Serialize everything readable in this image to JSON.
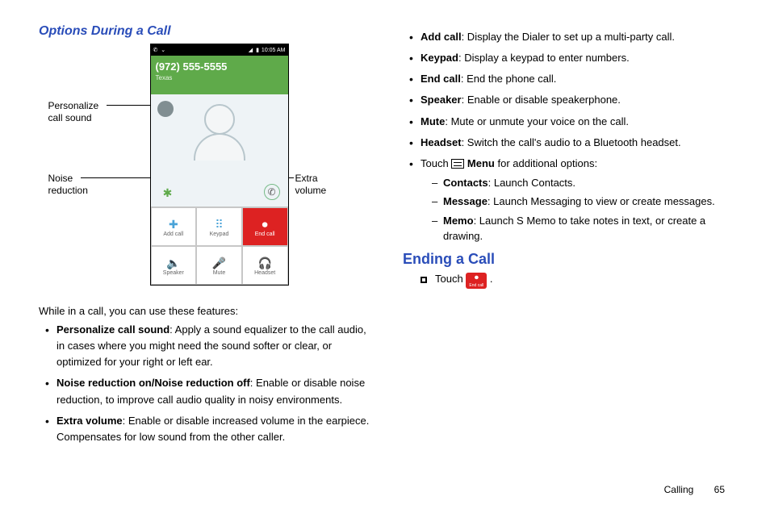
{
  "sections": {
    "options_title": "Options During a Call",
    "ending_title": "Ending a Call"
  },
  "phone": {
    "time": "10:05 AM",
    "signal_glyphs": "◢ ▮",
    "number": "(972) 555-5555",
    "location": "Texas",
    "noise_glyph": "✱",
    "extra_glyph": "✆",
    "buttons": {
      "add": {
        "label": "Add call",
        "glyph": "✚"
      },
      "keypad": {
        "label": "Keypad",
        "glyph": "⠿"
      },
      "end": {
        "label": "End call",
        "glyph": "⏺"
      },
      "speaker": {
        "label": "Speaker",
        "glyph": "🔈"
      },
      "mute": {
        "label": "Mute",
        "glyph": "🎤"
      },
      "headset": {
        "label": "Headset",
        "glyph": "🎧"
      }
    }
  },
  "callouts": {
    "pcs_l1": "Personalize",
    "pcs_l2": "call sound",
    "nr_l1": "Noise",
    "nr_l2": "reduction",
    "ev_l1": "Extra",
    "ev_l2": "volume"
  },
  "intro": "While in a call, you can use these features:",
  "left_bullets": {
    "pcs_term": "Personalize call sound",
    "pcs_desc": ": Apply a sound equalizer to the call audio, in cases where you might need the sound softer or clear, or optimized for your right or left ear.",
    "nr_term": "Noise reduction on/Noise reduction off",
    "nr_desc": ": Enable or disable noise reduction, to improve call audio quality in noisy environments.",
    "ev_term": "Extra volume",
    "ev_desc": ": Enable or disable increased volume in the earpiece. Compensates for low sound from the other caller."
  },
  "right_bullets": {
    "add_term": "Add call",
    "add_desc": ": Display the Dialer to set up a multi-party call.",
    "kp_term": "Keypad",
    "kp_desc": ": Display a keypad to enter numbers.",
    "end_term": "End call",
    "end_desc": ": End the phone call.",
    "sp_term": "Speaker",
    "sp_desc": ": Enable or disable speakerphone.",
    "mu_term": "Mute",
    "mu_desc": ": Mute or unmute your voice on the call.",
    "hs_term": "Headset",
    "hs_desc": ": Switch the call's audio to a Bluetooth headset.",
    "touch_pre": "Touch ",
    "menu_term": " Menu ",
    "touch_post": "for additional options:",
    "contacts_term": "Contacts",
    "contacts_desc": ": Launch Contacts.",
    "msg_term": "Message",
    "msg_desc": ": Launch Messaging to view or create messages.",
    "memo_term": "Memo",
    "memo_desc": ": Launch S Memo to take notes in text, or create a drawing."
  },
  "ending_line": {
    "touch": "Touch ",
    "period": " .",
    "end_glyph": "⏺",
    "end_label": "End call"
  },
  "footer": {
    "section": "Calling",
    "page": "65"
  }
}
